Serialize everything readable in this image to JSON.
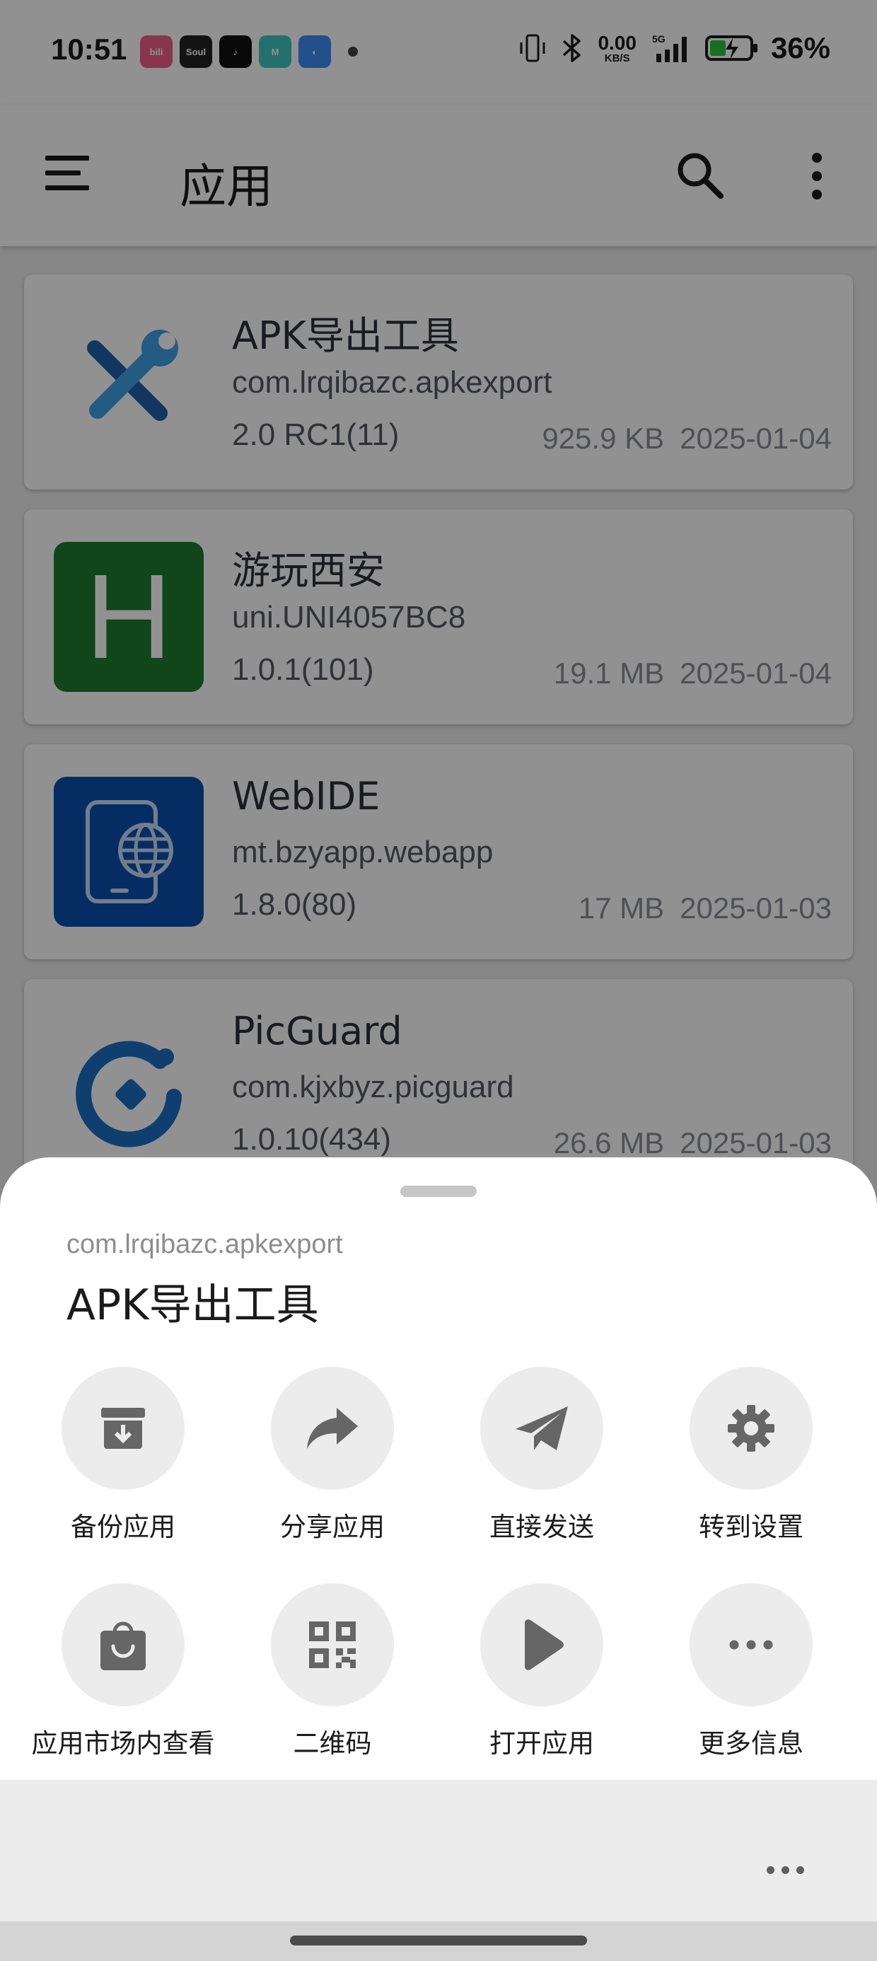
{
  "status_bar": {
    "time": "10:51",
    "notification_apps": [
      "bilibili",
      "Soul",
      "TikTok",
      "Magic",
      "Browser"
    ],
    "net_speed_value": "0.00",
    "net_speed_unit": "KB/S",
    "network_type": "5G",
    "battery_percent": "36%"
  },
  "toolbar": {
    "title": "应用",
    "menu_icon": "hamburger-menu-icon",
    "search_icon": "search-icon",
    "more_icon": "more-vertical-icon"
  },
  "apps": [
    {
      "name": "APK导出工具",
      "package": "com.lrqibazc.apkexport",
      "version": "2.0 RC1(11)",
      "size": "925.9 KB",
      "date": "2025-01-04",
      "icon": "wrench-screwdriver-icon"
    },
    {
      "name": "游玩西安",
      "package": "uni.UNI4057BC8",
      "version": "1.0.1(101)",
      "size": "19.1 MB",
      "date": "2025-01-04",
      "icon": "letter-h-icon",
      "icon_letter": "H"
    },
    {
      "name": "WebIDE",
      "package": "mt.bzyapp.webapp",
      "version": "1.8.0(80)",
      "size": "17 MB",
      "date": "2025-01-03",
      "icon": "phone-globe-icon"
    },
    {
      "name": "PicGuard",
      "package": "com.kjxbyz.picguard",
      "version": "1.0.10(434)",
      "size": "26.6 MB",
      "date": "2025-01-03",
      "icon": "picguard-logo-icon"
    }
  ],
  "sheet": {
    "package": "com.lrqibazc.apkexport",
    "title": "APK导出工具",
    "actions": [
      {
        "label": "备份应用",
        "icon": "archive-download-icon"
      },
      {
        "label": "分享应用",
        "icon": "share-arrow-icon"
      },
      {
        "label": "直接发送",
        "icon": "paper-plane-icon"
      },
      {
        "label": "转到设置",
        "icon": "gear-icon"
      },
      {
        "label": "应用市场内查看",
        "icon": "shopping-bag-icon"
      },
      {
        "label": "二维码",
        "icon": "qr-code-icon"
      },
      {
        "label": "打开应用",
        "icon": "play-icon"
      },
      {
        "label": "更多信息",
        "icon": "more-horizontal-icon"
      }
    ]
  },
  "colors": {
    "app_bar_bg": "#ffffff",
    "icon_green": "#1e7a2e",
    "icon_blue": "#0b4fae",
    "action_circle": "#ececec",
    "action_icon": "#666666"
  }
}
